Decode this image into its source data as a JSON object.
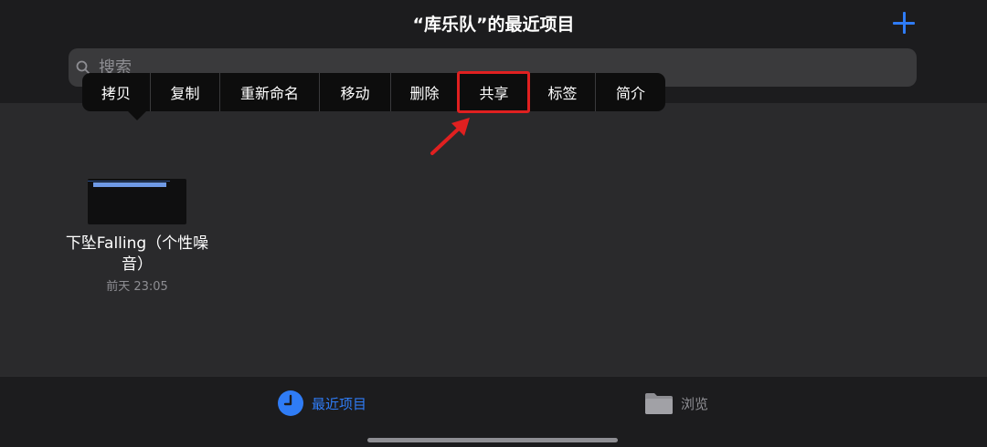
{
  "header": {
    "title": "“库乐队”的最近项目",
    "add_icon": "plus-icon"
  },
  "search": {
    "placeholder": "搜索",
    "icon": "search-icon"
  },
  "context_menu": {
    "items": [
      {
        "label": "拷贝"
      },
      {
        "label": "复制"
      },
      {
        "label": "重新命名"
      },
      {
        "label": "移动"
      },
      {
        "label": "删除"
      },
      {
        "label": "共享",
        "highlighted": true
      },
      {
        "label": "标签"
      },
      {
        "label": "简介"
      }
    ]
  },
  "file": {
    "name": "下坠Falling（个性噪音）",
    "date": "前天 23:05"
  },
  "tabs": [
    {
      "label": "最近项目",
      "icon": "clock-icon",
      "active": true
    },
    {
      "label": "浏览",
      "icon": "folder-icon",
      "active": false
    }
  ],
  "colors": {
    "accent": "#2f7cf6",
    "highlight_box": "#e02020",
    "background": "#2a2a2c",
    "menu_background": "#0d0d0d"
  }
}
